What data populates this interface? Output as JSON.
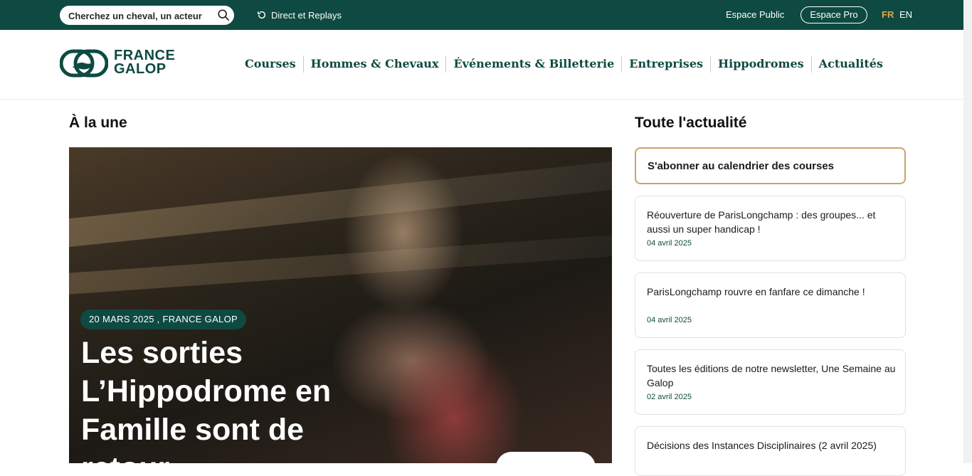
{
  "topbar": {
    "search_placeholder": "Cherchez un cheval, un acteur",
    "direct_label": "Direct et Replays",
    "espace_public": "Espace Public",
    "espace_pro": "Espace Pro",
    "lang_fr": "FR",
    "lang_en": "EN"
  },
  "logo": {
    "line1": "FRANCE",
    "line2": "GALOP"
  },
  "nav": {
    "items": [
      "Courses",
      "Hommes & Chevaux",
      "Événements & Billetterie",
      "Entreprises",
      "Hippodromes",
      "Actualités"
    ]
  },
  "featured": {
    "section_title": "À la une",
    "badge": "20 MARS 2025 , FRANCE GALOP",
    "headline": "Les sorties L’Hippodrome en Famille sont de retour"
  },
  "news": {
    "section_title": "Toute l'actualité",
    "subscribe_label": "S'abonner au calendrier des courses",
    "items": [
      {
        "title": "Réouverture de ParisLongchamp : des groupes... et aussi un super handicap !",
        "date": "04 avril 2025"
      },
      {
        "title": "ParisLongchamp rouvre en fanfare ce dimanche !",
        "date": "04 avril 2025"
      },
      {
        "title": "Toutes les éditions de notre newsletter, Une Semaine au Galop",
        "date": "02 avril 2025"
      },
      {
        "title": "Décisions des Instances Disciplinaires (2 avril 2025)",
        "date": ""
      }
    ]
  },
  "colors": {
    "brand_green": "#0e4a41",
    "accent_gold": "#c9a36a",
    "lang_active": "#e0a64a"
  }
}
